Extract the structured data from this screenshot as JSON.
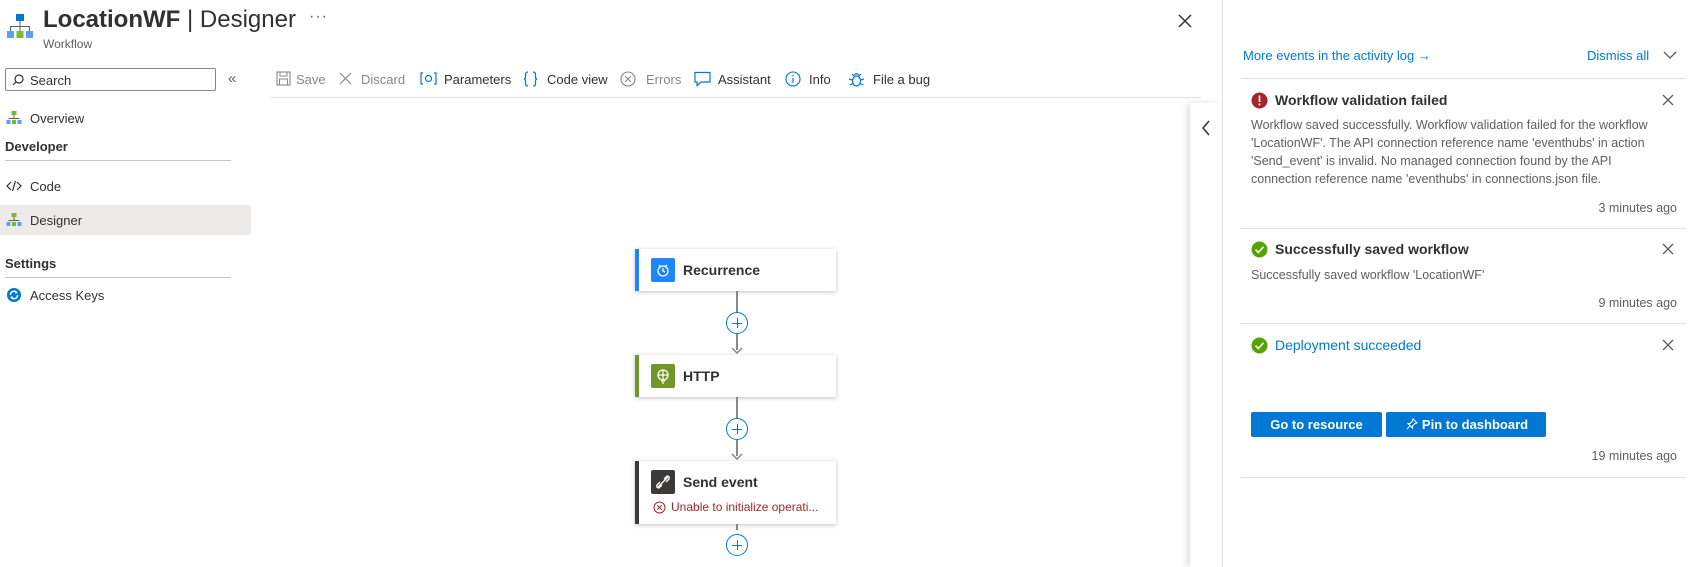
{
  "header": {
    "title_main": "LocationWF",
    "title_sep": " | ",
    "title_suffix": "Designer",
    "subtitle": "Workflow",
    "more": "···"
  },
  "sidebar": {
    "search_placeholder": "Search",
    "collapse": "«",
    "items": [
      {
        "label": "Overview",
        "icon": "workflow-icon"
      },
      {
        "label": "Code",
        "icon": "code-icon"
      },
      {
        "label": "Designer",
        "icon": "workflow-icon",
        "selected": true
      },
      {
        "label": "Access Keys",
        "icon": "access-keys-icon"
      }
    ],
    "sections": [
      "Developer",
      "Settings"
    ]
  },
  "toolbar": {
    "save": "Save",
    "discard": "Discard",
    "parameters": "Parameters",
    "code_view": "Code view",
    "errors": "Errors",
    "assistant": "Assistant",
    "info": "Info",
    "file_bug": "File a bug"
  },
  "designer": {
    "cards": [
      {
        "title": "Recurrence",
        "accent": "#1f85ff",
        "icon_bg": "#1f85ff",
        "icon": "clock-icon"
      },
      {
        "title": "HTTP",
        "accent": "#709727",
        "icon_bg": "#709727",
        "icon": "globe-icon"
      },
      {
        "title": "Send event",
        "accent": "#3b3a39",
        "icon_bg": "#3b3a39",
        "icon": "event-hubs-icon",
        "error": "Unable to initialize operati..."
      }
    ]
  },
  "notifications": {
    "activity_link": "More events in the activity log →",
    "dismiss_all": "Dismiss all",
    "items": [
      {
        "title": "Workflow validation failed",
        "status": "error",
        "body": "Workflow saved successfully. Workflow validation failed for the workflow 'LocationWF'. The API connection reference name 'eventhubs' in action 'Send_event' is invalid. No managed connection found by the API connection reference name 'eventhubs' in connections.json file.",
        "time": "3 minutes ago"
      },
      {
        "title": "Successfully saved workflow",
        "status": "success",
        "body": "Successfully saved workflow 'LocationWF'",
        "time": "9 minutes ago"
      },
      {
        "title": "Deployment succeeded",
        "status": "success",
        "buttons": {
          "go": "Go to resource",
          "pin": "Pin to dashboard"
        },
        "time": "19 minutes ago"
      }
    ]
  },
  "colors": {
    "accent": "#0078d4",
    "error": "#a4262c",
    "success": "#57a300"
  }
}
